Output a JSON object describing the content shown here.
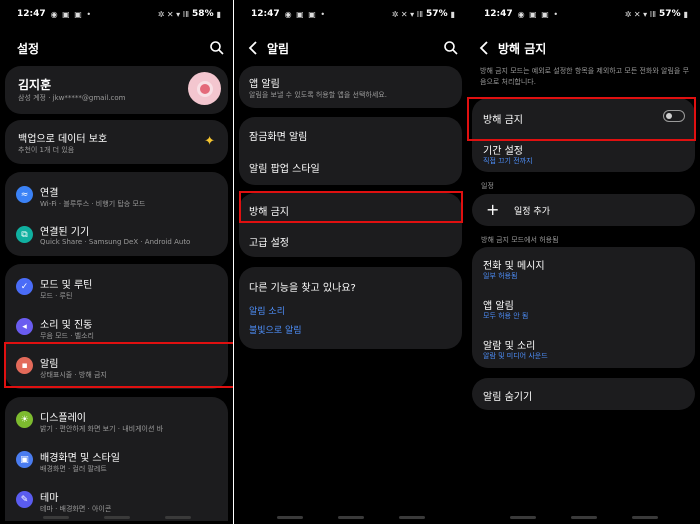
{
  "status": {
    "s1": {
      "time": "12:47",
      "battery": "58%"
    },
    "s2": {
      "time": "12:47",
      "battery": "57%"
    },
    "s3": {
      "time": "12:47",
      "battery": "57%"
    }
  },
  "screen1": {
    "title": "설정",
    "profile": {
      "name": "김지훈",
      "sub": "삼성 계정 · jkw*****@gmail.com"
    },
    "backup": {
      "title": "백업으로 데이터 보호",
      "sub": "추천이 1개 더 있음"
    },
    "items": [
      {
        "label": "연결",
        "sub": "Wi-Fi · 블루투스 · 비행기 탑승 모드",
        "color": "#3b82f6"
      },
      {
        "label": "연결된 기기",
        "sub": "Quick Share · Samsung DeX · Android Auto",
        "color": "#10b0a0"
      },
      {
        "label": "모드 및 루틴",
        "sub": "모드 · 루틴",
        "color": "#4a6cf7"
      },
      {
        "label": "소리 및 진동",
        "sub": "무음 모드 · 벨소리",
        "color": "#6a5cf0"
      },
      {
        "label": "알림",
        "sub": "상태표시줄 · 방해 금지",
        "color": "#e36a5a"
      },
      {
        "label": "디스플레이",
        "sub": "밝기 · 편안하게 화면 보기 · 내비게이션 바",
        "color": "#7dbb2f"
      },
      {
        "label": "배경화면 및 스타일",
        "sub": "배경화면 · 컬러 팔레트",
        "color": "#4a7cf0"
      },
      {
        "label": "테마",
        "sub": "테마 · 배경화면 · 아이콘",
        "color": "#5a5cf0"
      }
    ]
  },
  "screen2": {
    "title": "알림",
    "app_notif": {
      "title": "앱 알림",
      "sub": "알림을 보낼 수 있도록 허용할 앱을 선택하세요."
    },
    "group1": [
      "잠금화면 알림",
      "알림 팝업 스타일"
    ],
    "dnd": "방해 금지",
    "advanced": "고급 설정",
    "looking": {
      "title": "다른 기능을 찾고 있나요?",
      "links": [
        "알림 소리",
        "불빛으로 알림"
      ]
    }
  },
  "screen3": {
    "title": "방해 금지",
    "desc": "방해 금지 모드는 예외로 설정한 항목을 제외하고 모든 전화와 알림을 무음으로 처리합니다.",
    "toggle_label": "방해 금지",
    "toggle_on": false,
    "duration": {
      "title": "기간 설정",
      "sub": "직접 끄기 전까지"
    },
    "schedule_section": "일정",
    "add_schedule": "일정 추가",
    "allowed_section": "방해 금지 모드에서 허용됨",
    "allowed": [
      {
        "title": "전화 및 메시지",
        "sub": "일부 허용됨"
      },
      {
        "title": "앱 알림",
        "sub": "모두 허용 안 됨"
      },
      {
        "title": "알람 및 소리",
        "sub": "알람 및 미디어 사운드"
      }
    ],
    "hide_notif": "알림 숨기기"
  }
}
